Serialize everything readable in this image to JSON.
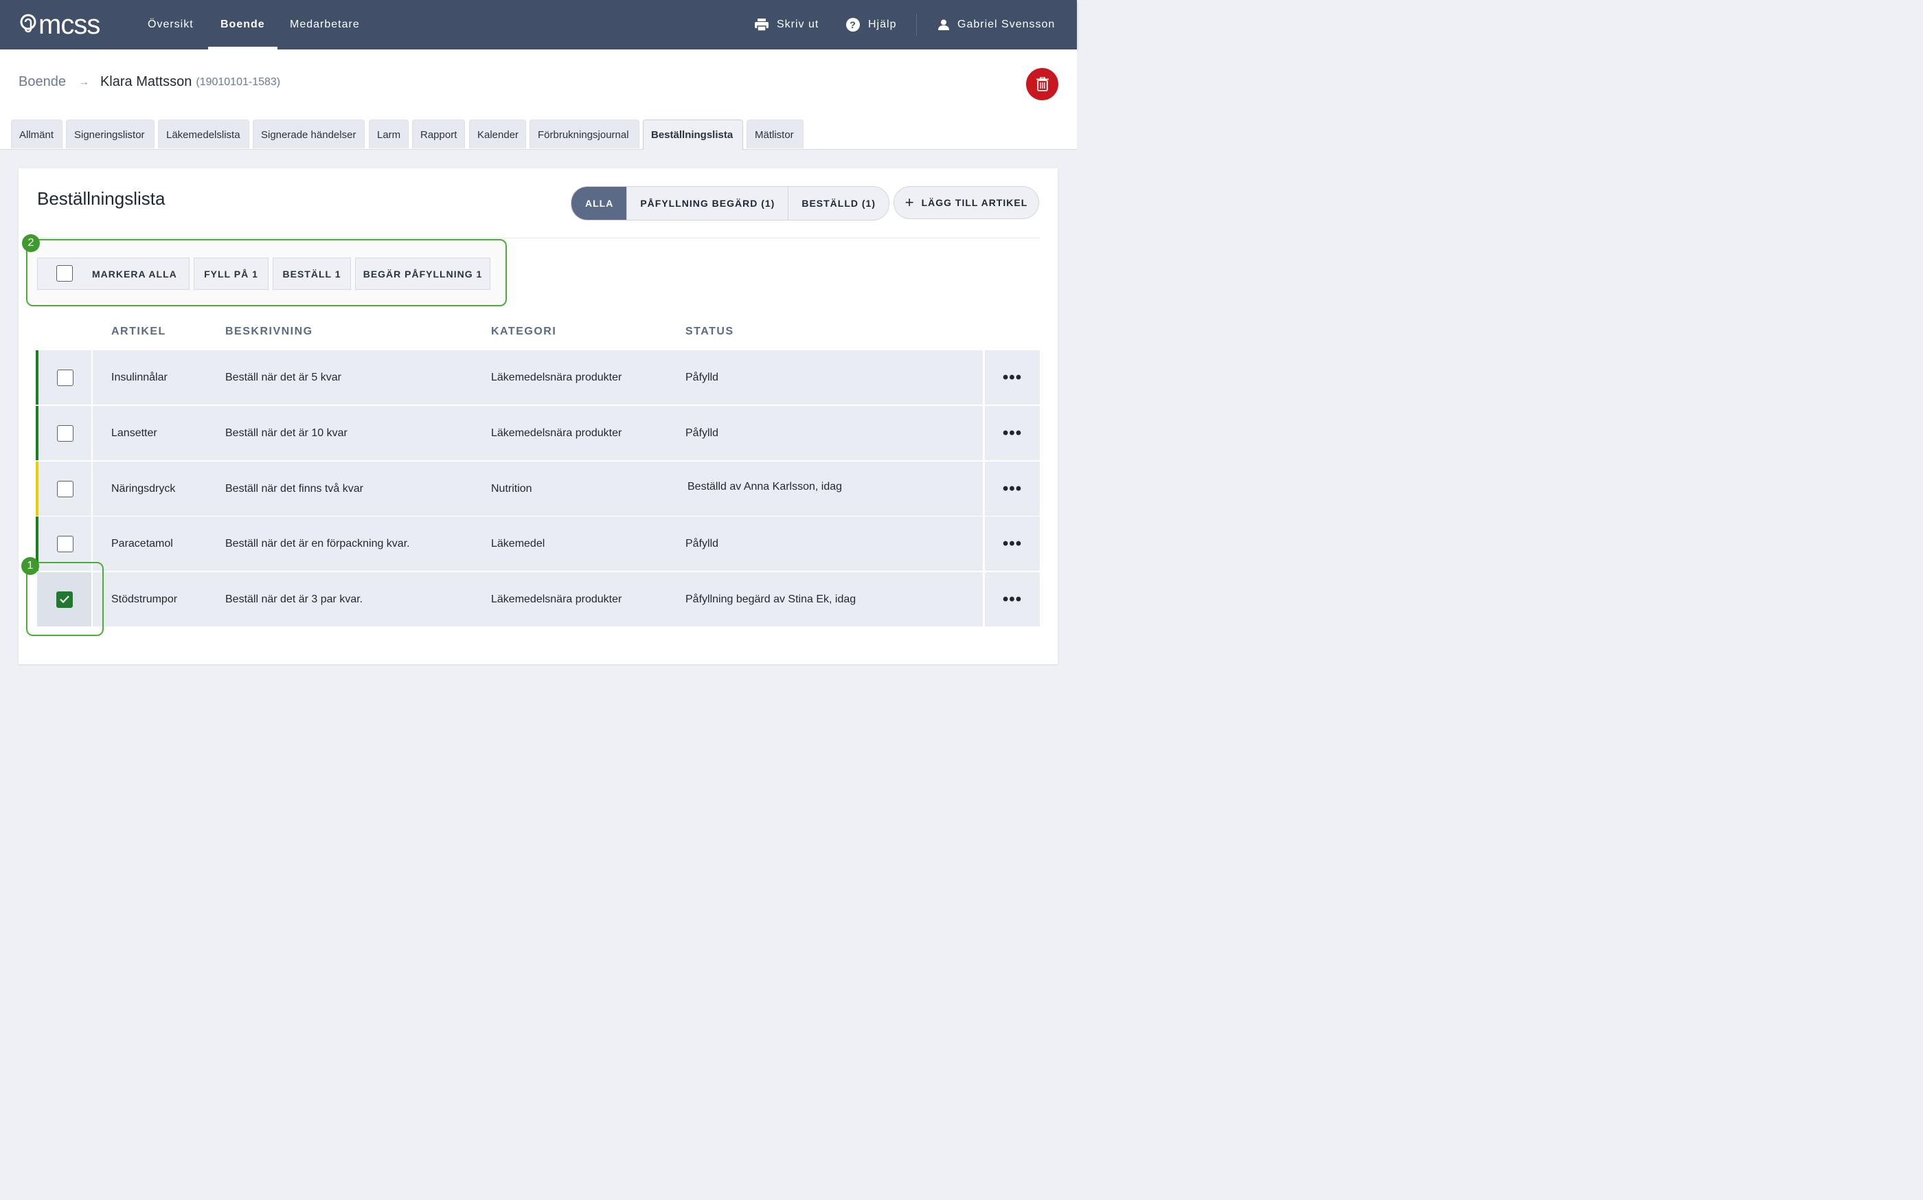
{
  "topbar": {
    "logo_text": "mcss",
    "nav": [
      "Översikt",
      "Boende",
      "Medarbetare"
    ],
    "active_nav": "Boende",
    "print_label": "Skriv ut",
    "help_label": "Hjälp",
    "user_name": "Gabriel Svensson"
  },
  "breadcrumb": {
    "root": "Boende",
    "name": "Klara Mattsson",
    "id": "(19010101-1583)"
  },
  "tabs": [
    "Allmänt",
    "Signeringslistor",
    "Läkemedelslista",
    "Signerade händelser",
    "Larm",
    "Rapport",
    "Kalender",
    "Förbrukningsjournal",
    "Beställningslista",
    "Mätlistor"
  ],
  "active_tab": "Beställningslista",
  "card": {
    "title": "Beställningslista",
    "filters": [
      "ALLA",
      "PÅFYLLNING BEGÄRD (1)",
      "BESTÄLLD (1)"
    ],
    "active_filter": "ALLA",
    "add_label": "LÄGG TILL ARTIKEL"
  },
  "toolbar": {
    "select_all": "MARKERA ALLA",
    "refill": "FYLL PÅ 1",
    "order": "BESTÄLL 1",
    "request_refill": "BEGÄR PÅFYLLNING 1"
  },
  "badges": {
    "one": "1",
    "two": "2"
  },
  "table": {
    "headers": [
      "ARTIKEL",
      "BESKRIVNING",
      "KATEGORI",
      "STATUS"
    ],
    "rows": [
      {
        "article": "Insulinnålar",
        "description": "Beställ när det är 5 kvar",
        "category": "Läkemedelsnära produkter",
        "status": "Påfylld",
        "status_color": "#1a7f1f",
        "checked": false
      },
      {
        "article": "Lansetter",
        "description": "Beställ när det är 10 kvar",
        "category": "Läkemedelsnära produkter",
        "status": "Påfylld",
        "status_color": "#1a7f1f",
        "checked": false
      },
      {
        "article": "Näringsdryck",
        "description": "Beställ när det finns två kvar",
        "category": "Nutrition",
        "status": "Beställd av Anna Karlsson, idag",
        "status_color": "#e8cf00",
        "checked": false
      },
      {
        "article": "Paracetamol",
        "description": "Beställ när det är en förpackning kvar.",
        "category": "Läkemedel",
        "status": "Påfylld",
        "status_color": "#1a7f1f",
        "checked": false
      },
      {
        "article": "Stödstrumpor",
        "description": "Beställ när det är 3 par kvar.",
        "category": "Läkemedelsnära produkter",
        "status": "Påfyllning begärd av Stina Ek, idag",
        "status_color": "",
        "checked": true
      }
    ],
    "more_label": "•••"
  }
}
